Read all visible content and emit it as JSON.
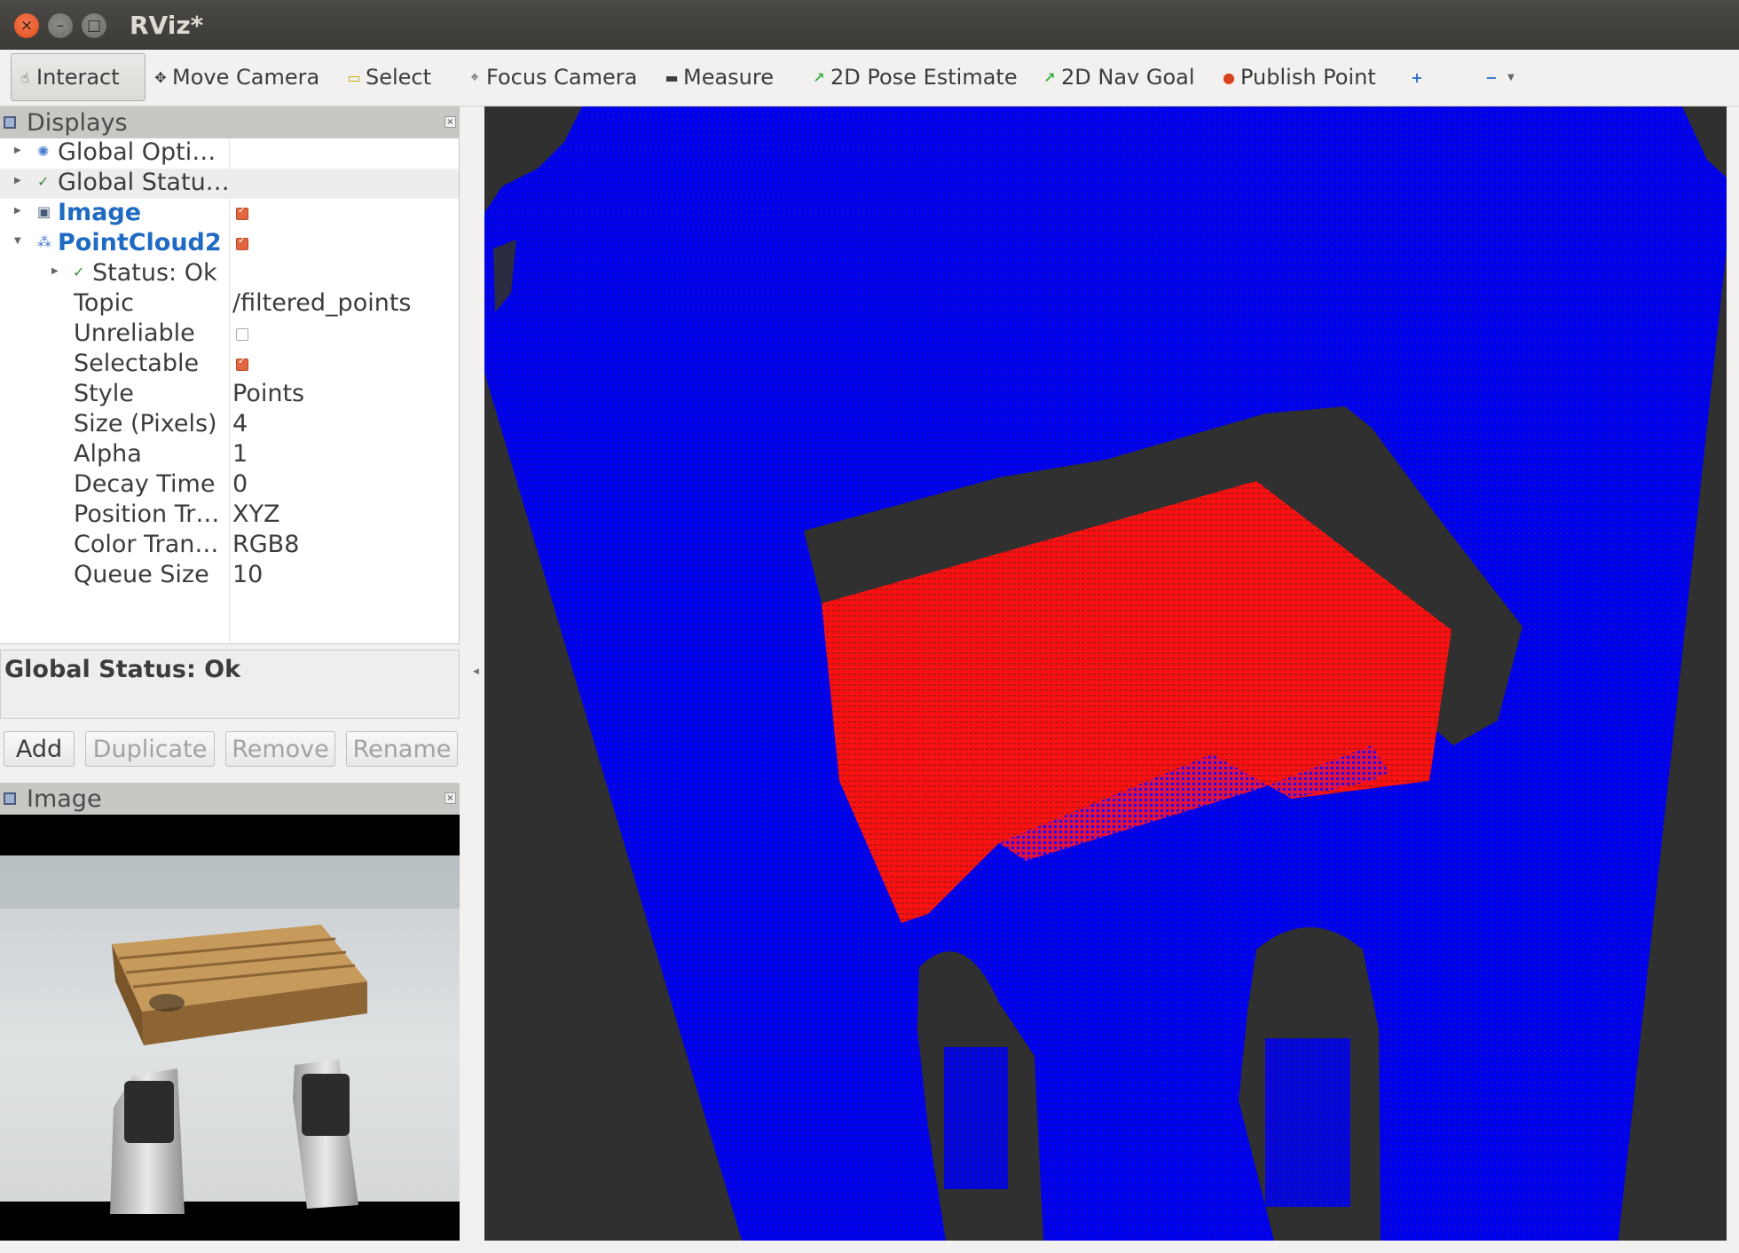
{
  "window": {
    "title": "RViz*"
  },
  "toolbar": {
    "interact": "Interact",
    "move_camera": "Move Camera",
    "select": "Select",
    "focus_camera": "Focus Camera",
    "measure": "Measure",
    "pose_estimate": "2D Pose Estimate",
    "nav_goal": "2D Nav Goal",
    "publish_point": "Publish Point"
  },
  "displays_panel": {
    "title": "Displays",
    "items": {
      "global_options": "Global Opti…",
      "global_status": "Global Statu…",
      "image": "Image",
      "pointcloud": "PointCloud2",
      "status_ok": "Status: Ok"
    },
    "properties": [
      {
        "name": "Topic",
        "value": "/filtered_points"
      },
      {
        "name": "Unreliable",
        "value": ""
      },
      {
        "name": "Selectable",
        "value": ""
      },
      {
        "name": "Style",
        "value": "Points"
      },
      {
        "name": "Size (Pixels)",
        "value": "4"
      },
      {
        "name": "Alpha",
        "value": "1"
      },
      {
        "name": "Decay Time",
        "value": "0"
      },
      {
        "name": "Position Tr…",
        "value": "XYZ"
      },
      {
        "name": "Color Tran…",
        "value": "RGB8"
      },
      {
        "name": "Queue Size",
        "value": "10"
      }
    ],
    "checkboxes": {
      "image": true,
      "pointcloud": true,
      "unreliable": false,
      "selectable": true
    },
    "status_text": "Global Status: Ok",
    "buttons": {
      "add": "Add",
      "duplicate": "Duplicate",
      "remove": "Remove",
      "rename": "Rename"
    }
  },
  "image_panel": {
    "title": "Image"
  },
  "colors": {
    "background": "#303030",
    "ground_points": "#0000ff",
    "pallet_points": "#ff0000",
    "link_blue": "#1f6bc2",
    "checkbox_orange": "#e2673f"
  }
}
